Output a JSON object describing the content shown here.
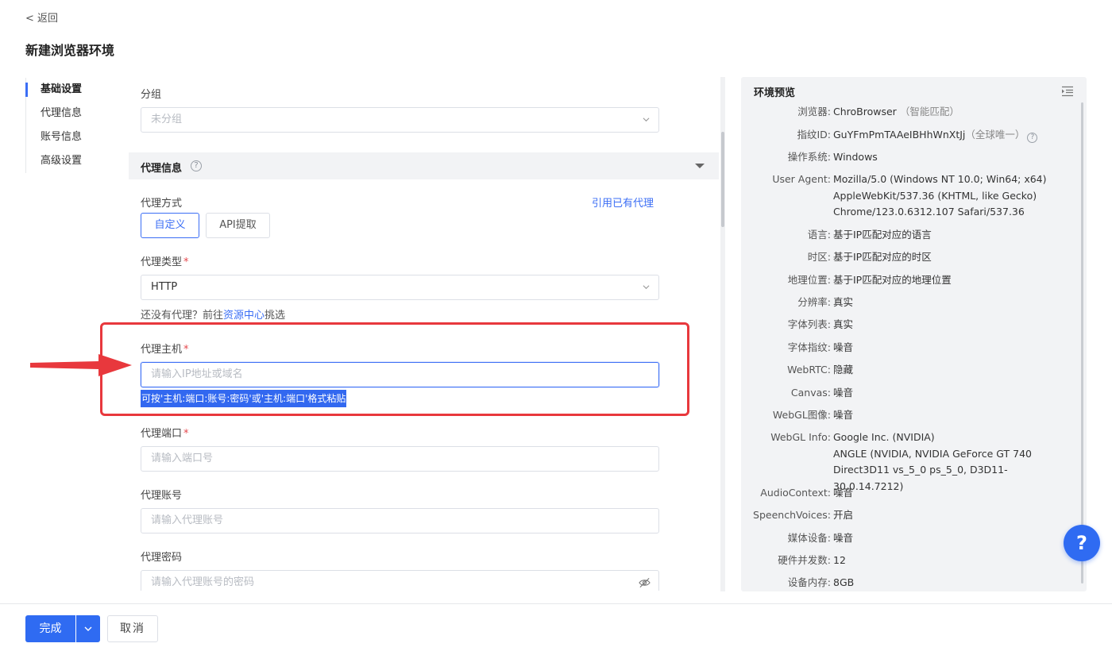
{
  "header": {
    "back_label": "< 返回",
    "title": "新建浏览器环境"
  },
  "side_nav": {
    "items": [
      {
        "label": "基础设置",
        "active": true
      },
      {
        "label": "代理信息",
        "active": false
      },
      {
        "label": "账号信息",
        "active": false
      },
      {
        "label": "高级设置",
        "active": false
      }
    ]
  },
  "form": {
    "group": {
      "label": "分组",
      "placeholder": "未分组"
    },
    "proxy_section": {
      "title": "代理信息",
      "help_icon": "question-circle-icon"
    },
    "proxy_method": {
      "label": "代理方式",
      "use_existing_link": "引用已有代理",
      "options": [
        "自定义",
        "API提取"
      ],
      "selected": "自定义"
    },
    "proxy_type": {
      "label": "代理类型",
      "required_mark": "*",
      "value": "HTTP",
      "hint_prefix": "还没有代理？前往",
      "hint_link": "资源中心",
      "hint_suffix": "挑选"
    },
    "proxy_host": {
      "label": "代理主机",
      "required_mark": "*",
      "placeholder": "请输入IP地址或域名",
      "paste_hint": "可按'主机:端口:账号:密码'或'主机:端口'格式粘贴"
    },
    "proxy_port": {
      "label": "代理端口",
      "required_mark": "*",
      "placeholder": "请输入端口号"
    },
    "proxy_account": {
      "label": "代理账号",
      "placeholder": "请输入代理账号"
    },
    "proxy_password": {
      "label": "代理密码",
      "placeholder": "请输入代理账号的密码"
    }
  },
  "preview": {
    "title": "环境预览",
    "rows": [
      {
        "key": "浏览器",
        "value": "ChroBrowser",
        "extra": "（智能匹配）"
      },
      {
        "key": "指纹ID",
        "value": "GuYFmPmTAAeIBHhWnXtJj",
        "extra": "（全球唯一）",
        "has_help": true
      },
      {
        "key": "操作系统",
        "value": "Windows"
      },
      {
        "key": "User Agent",
        "value": "Mozilla/5.0 (Windows NT 10.0; Win64; x64)\nAppleWebKit/537.36 (KHTML, like Gecko)\nChrome/123.0.6312.107 Safari/537.36"
      },
      {
        "key": "语言",
        "value": "基于IP匹配对应的语言"
      },
      {
        "key": "时区",
        "value": "基于IP匹配对应的时区"
      },
      {
        "key": "地理位置",
        "value": "基于IP匹配对应的地理位置"
      },
      {
        "key": "分辨率",
        "value": "真实"
      },
      {
        "key": "字体列表",
        "value": "真实"
      },
      {
        "key": "字体指纹",
        "value": "噪音"
      },
      {
        "key": "WebRTC",
        "value": "隐藏"
      },
      {
        "key": "Canvas",
        "value": "噪音"
      },
      {
        "key": "WebGL图像",
        "value": "噪音"
      },
      {
        "key": "WebGL Info",
        "value": "Google Inc. (NVIDIA)\nANGLE (NVIDIA, NVIDIA GeForce GT 740\nDirect3D11 vs_5_0 ps_5_0, D3D11-30.0.14.7212)"
      },
      {
        "key": "AudioContext",
        "value": "噪音"
      },
      {
        "key": "SpeenchVoices",
        "value": "开启"
      },
      {
        "key": "媒体设备",
        "value": "噪音"
      },
      {
        "key": "硬件并发数",
        "value": "12"
      },
      {
        "key": "设备内存",
        "value": "8GB"
      }
    ]
  },
  "help_fab": {
    "label": "?"
  },
  "footer": {
    "done_label": "完成",
    "cancel_label": "取消"
  },
  "colors": {
    "accent": "#2f6bf2",
    "annotation_red": "#e8383d",
    "preview_bg": "#f2f3f5"
  }
}
